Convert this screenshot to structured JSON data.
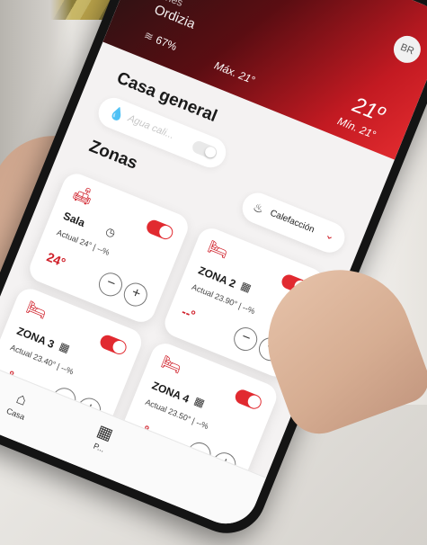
{
  "weather": {
    "city_partial": "ones",
    "city": "Ordizia",
    "humidity": "67%",
    "max": "Máx. 21°",
    "temp": "21º",
    "min": "Mín. 21°"
  },
  "user": {
    "initials": "BR"
  },
  "house": {
    "title": "Casa general",
    "water_label": "Agua cali...",
    "water_on": false
  },
  "zones_section": {
    "title": "Zonas",
    "mode_label": "Calefacción"
  },
  "zones": [
    {
      "name": "Sala",
      "actual": "Actual 24° | --%",
      "setpoint": "24°",
      "on": true,
      "icon": "sofa-icon"
    },
    {
      "name": "ZONA 2",
      "actual": "Actual 23.90° | --%",
      "setpoint": "--°",
      "on": true,
      "icon": "bed-icon"
    },
    {
      "name": "ZONA 3",
      "actual": "Actual 23.40° | --%",
      "setpoint": "--°",
      "on": true,
      "icon": "bed-icon"
    },
    {
      "name": "ZONA 4",
      "actual": "Actual 23.50° | --%",
      "setpoint": "--°",
      "on": true,
      "icon": "bed-icon"
    }
  ],
  "nav": {
    "home_label": "Casa",
    "prog_label": "P..."
  },
  "colors": {
    "accent": "#d0202a",
    "weather_dark": "#1d1414",
    "weather_red": "#e02a2e"
  }
}
